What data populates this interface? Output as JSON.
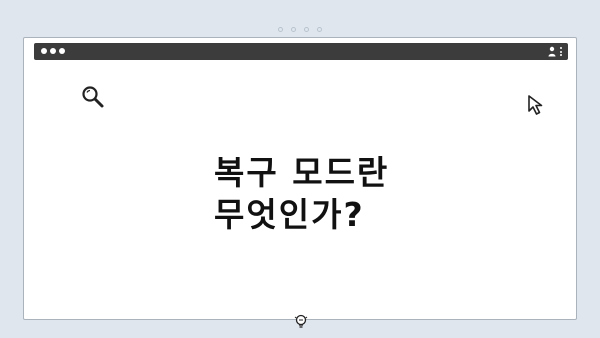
{
  "slide": {
    "title_line1": "복구 모드란",
    "title_line2": "무엇인가?"
  },
  "icons": {
    "search": "search-icon",
    "cursor": "cursor-icon",
    "lightbulb": "lightbulb-icon",
    "account": "account-icon",
    "menu": "kebab-menu-icon"
  },
  "colors": {
    "background": "#dfe6ee",
    "titlebar": "#3c3c3c",
    "window": "#ffffff",
    "text": "#111111"
  }
}
